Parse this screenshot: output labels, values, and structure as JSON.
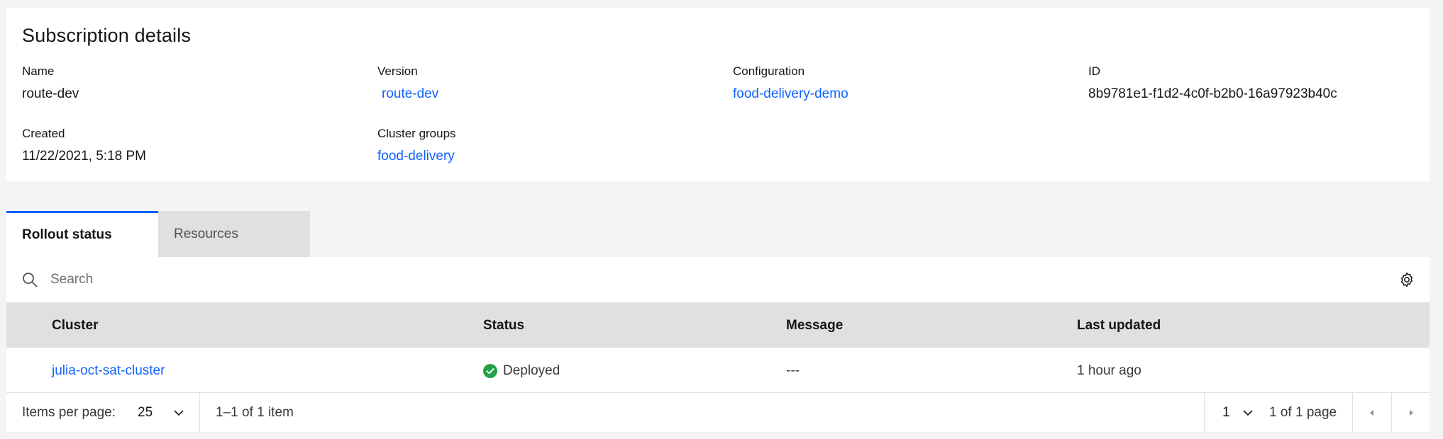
{
  "details": {
    "title": "Subscription details",
    "name_label": "Name",
    "name_value": "route-dev",
    "version_label": "Version",
    "version_value": "route-dev",
    "configuration_label": "Configuration",
    "configuration_value": "food-delivery-demo",
    "id_label": "ID",
    "id_value": "8b9781e1-f1d2-4c0f-b2b0-16a97923b40c",
    "created_label": "Created",
    "created_value": "11/22/2021, 5:18 PM",
    "cluster_groups_label": "Cluster groups",
    "cluster_groups_value": "food-delivery"
  },
  "tabs": [
    {
      "label": "Rollout status",
      "active": true
    },
    {
      "label": "Resources",
      "active": false
    }
  ],
  "search": {
    "placeholder": "Search",
    "icon": "search-icon"
  },
  "table": {
    "columns": [
      "Cluster",
      "Status",
      "Message",
      "Last updated"
    ],
    "rows": [
      {
        "cluster": "julia-oct-sat-cluster",
        "status": "Deployed",
        "message": "---",
        "last_updated": "1 hour ago"
      }
    ]
  },
  "pagination": {
    "items_per_page_label": "Items per page:",
    "items_per_page_value": "25",
    "range_text": "1–1 of 1 item",
    "page_value": "1",
    "page_total_text": "1 of 1 page"
  },
  "colors": {
    "link": "#0f62fe",
    "success": "#24a148",
    "header_bg": "#e0e0e0",
    "page_bg": "#f4f4f4"
  }
}
